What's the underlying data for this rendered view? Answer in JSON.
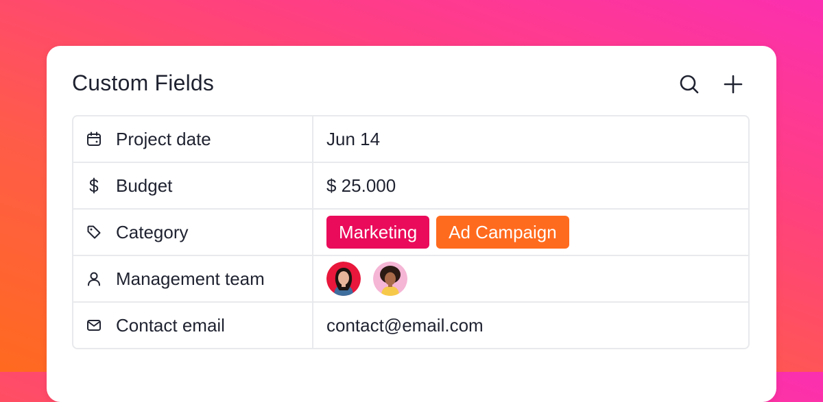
{
  "card": {
    "title": "Custom Fields",
    "search_icon": "search-icon",
    "add_icon": "plus-icon"
  },
  "fields": [
    {
      "icon": "calendar-icon",
      "label": "Project date",
      "value": "Jun 14"
    },
    {
      "icon": "dollar-icon",
      "label": "Budget",
      "value": "$ 25.000"
    },
    {
      "icon": "tag-icon",
      "label": "Category",
      "tags": [
        {
          "label": "Marketing",
          "color": "#ea0b5a"
        },
        {
          "label": "Ad Campaign",
          "color": "#ff6b1e"
        }
      ]
    },
    {
      "icon": "user-icon",
      "label": "Management team",
      "avatars": [
        {
          "name": "avatar-1",
          "ring": "#e8173b"
        },
        {
          "name": "avatar-2",
          "ring": "#f5b5d5"
        }
      ]
    },
    {
      "icon": "mail-icon",
      "label": "Contact email",
      "value": "contact@email.com"
    }
  ],
  "colors": {
    "background_top": "#fb2fb0",
    "background_bottom": "#ff6a1f",
    "text": "#1f2230",
    "border": "#e8e9ec"
  }
}
